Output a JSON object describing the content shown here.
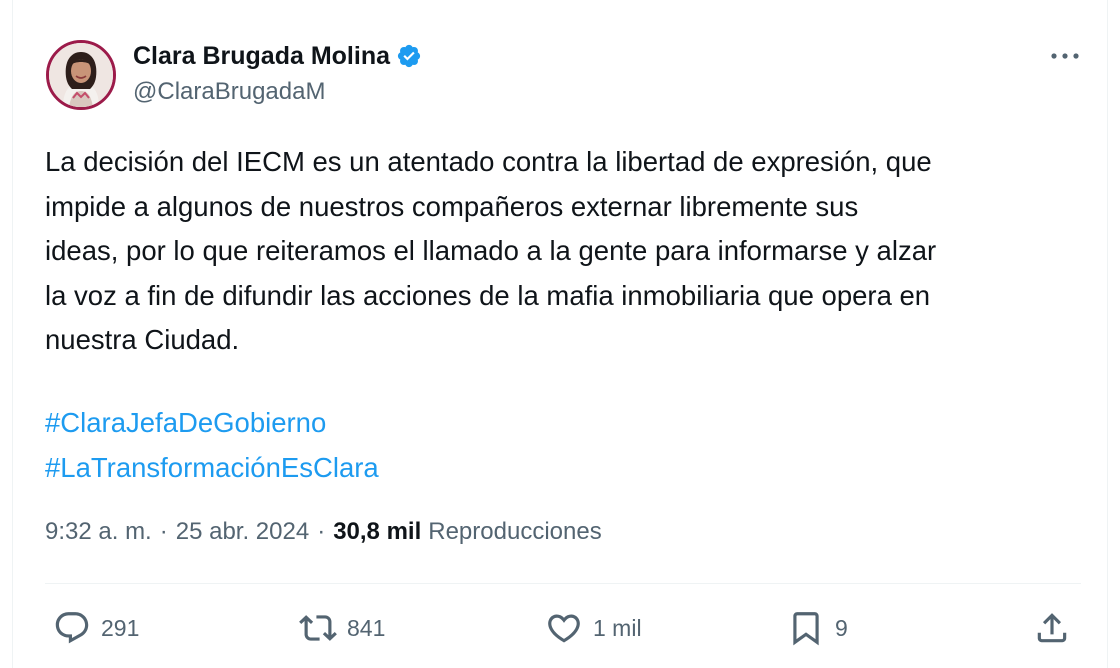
{
  "author": {
    "name": "Clara Brugada Molina",
    "handle": "@ClaraBrugadaM",
    "verified": true
  },
  "tweet": {
    "lines": [
      "La decisión del IECM es un atentado contra la libertad de expresión, que",
      "impide a algunos de nuestros compañeros externar libremente sus",
      "ideas, por lo que reiteramos el llamado a la gente para informarse y alzar",
      "la voz a fin de difundir las acciones de la mafia inmobiliaria que opera en",
      "nuestra Ciudad."
    ],
    "hashtags": [
      "#ClaraJefaDeGobierno",
      "#LaTransformaciónEsClara"
    ]
  },
  "meta": {
    "time": "9:32 a. m.",
    "separator": "·",
    "date": "25 abr. 2024",
    "views_count": "30,8 mil",
    "views_label": "Reproducciones"
  },
  "actions": {
    "replies": "291",
    "reposts": "841",
    "likes": "1 mil",
    "bookmarks": "9"
  },
  "colors": {
    "text": "#0f1419",
    "secondary": "#536471",
    "link": "#1d9bf0",
    "verified": "#1d9bf0",
    "divider": "#eff3f4",
    "avatar_ring": "#9c1b4a"
  },
  "icons": {
    "verified": "verified-badge-icon",
    "more": "more-horizontal-icon",
    "reply": "reply-bubble-icon",
    "repost": "repost-arrows-icon",
    "like": "heart-icon",
    "bookmark": "bookmark-icon",
    "share": "share-upload-icon"
  }
}
